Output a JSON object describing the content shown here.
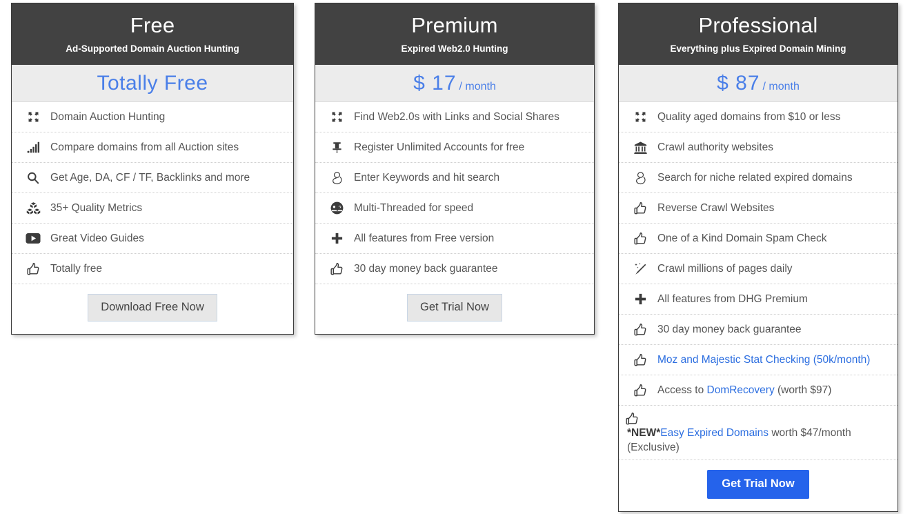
{
  "plans": [
    {
      "id": "free",
      "name": "Free",
      "tagline": "Ad-Supported Domain Auction Hunting",
      "price_main": "Totally Free",
      "price_period": "",
      "cta_label": "Download Free Now",
      "accent_color": "#424242",
      "header_bg": "#424242",
      "price_color": "#4a7fe8",
      "features": [
        {
          "icon": "expand-arrows-icon",
          "text": "Domain Auction Hunting"
        },
        {
          "icon": "signal-bars-icon",
          "text": "Compare domains from all Auction sites"
        },
        {
          "icon": "magnifier-icon",
          "text": "Get Age, DA, CF / TF, Backlinks and more"
        },
        {
          "icon": "cubes-icon",
          "text": "35+ Quality Metrics"
        },
        {
          "icon": "play-button-icon",
          "text": "Great Video Guides"
        },
        {
          "icon": "thumbs-up-icon",
          "text": "Totally free"
        }
      ]
    },
    {
      "id": "premium",
      "name": "Premium",
      "tagline": "Expired Web2.0 Hunting",
      "price_main": "$ 17",
      "price_period": "/ month",
      "cta_label": "Get Trial Now",
      "accent_color": "#424242",
      "header_bg": "#424242",
      "price_color": "#4a7fe8",
      "features": [
        {
          "icon": "expand-arrows-icon",
          "text": "Find Web2.0s with Links and Social Shares"
        },
        {
          "icon": "pushpin-icon",
          "text": "Register Unlimited Accounts for free"
        },
        {
          "icon": "google-g-icon",
          "text": "Enter Keywords and hit search"
        },
        {
          "icon": "speedometer-icon",
          "text": "Multi-Threaded for speed"
        },
        {
          "icon": "plus-icon",
          "text": "All features from Free version"
        },
        {
          "icon": "thumbs-up-icon",
          "text": "30 day money back guarantee"
        }
      ]
    },
    {
      "id": "professional",
      "name": "Professional",
      "tagline": "Everything plus Expired Domain Mining",
      "price_main": "$ 87",
      "price_period": "/ month",
      "cta_label": "Get Trial Now",
      "accent_color": "#2563eb",
      "header_bg": "#2563eb",
      "price_color": "#4a7fe8",
      "features": [
        {
          "icon": "expand-arrows-icon",
          "text": "Quality aged domains from $10 or less"
        },
        {
          "icon": "bank-icon",
          "text": "Crawl authority websites"
        },
        {
          "icon": "google-g-icon",
          "text": "Search for niche related expired domains"
        },
        {
          "icon": "thumbs-up-icon",
          "text": "Reverse Crawl Websites"
        },
        {
          "icon": "thumbs-up-icon",
          "text": "One of a Kind Domain Spam Check"
        },
        {
          "icon": "magic-wand-icon",
          "text": "Crawl millions of pages daily"
        },
        {
          "icon": "plus-icon",
          "text": "All features from DHG Premium"
        },
        {
          "icon": "thumbs-up-icon",
          "text": "30 day money back guarantee"
        },
        {
          "icon": "thumbs-up-icon",
          "text": "Moz and Majestic Stat Checking (50k/month)",
          "link_text": "Moz and Majestic Stat Checking (50k/month)"
        },
        {
          "icon": "thumbs-up-icon",
          "text": "Access to DomRecovery (worth $97)",
          "prefix": "Access to ",
          "link_text": "DomRecovery",
          "suffix": " (worth $97)"
        },
        {
          "icon": "thumbs-up-icon",
          "text": "*NEW*Easy Expired Domains worth $47/month (Exclusive)",
          "bold_prefix": "*NEW*",
          "link_text": "Easy Expired Domains",
          "suffix": " worth $47/month (Exclusive)"
        }
      ]
    }
  ]
}
